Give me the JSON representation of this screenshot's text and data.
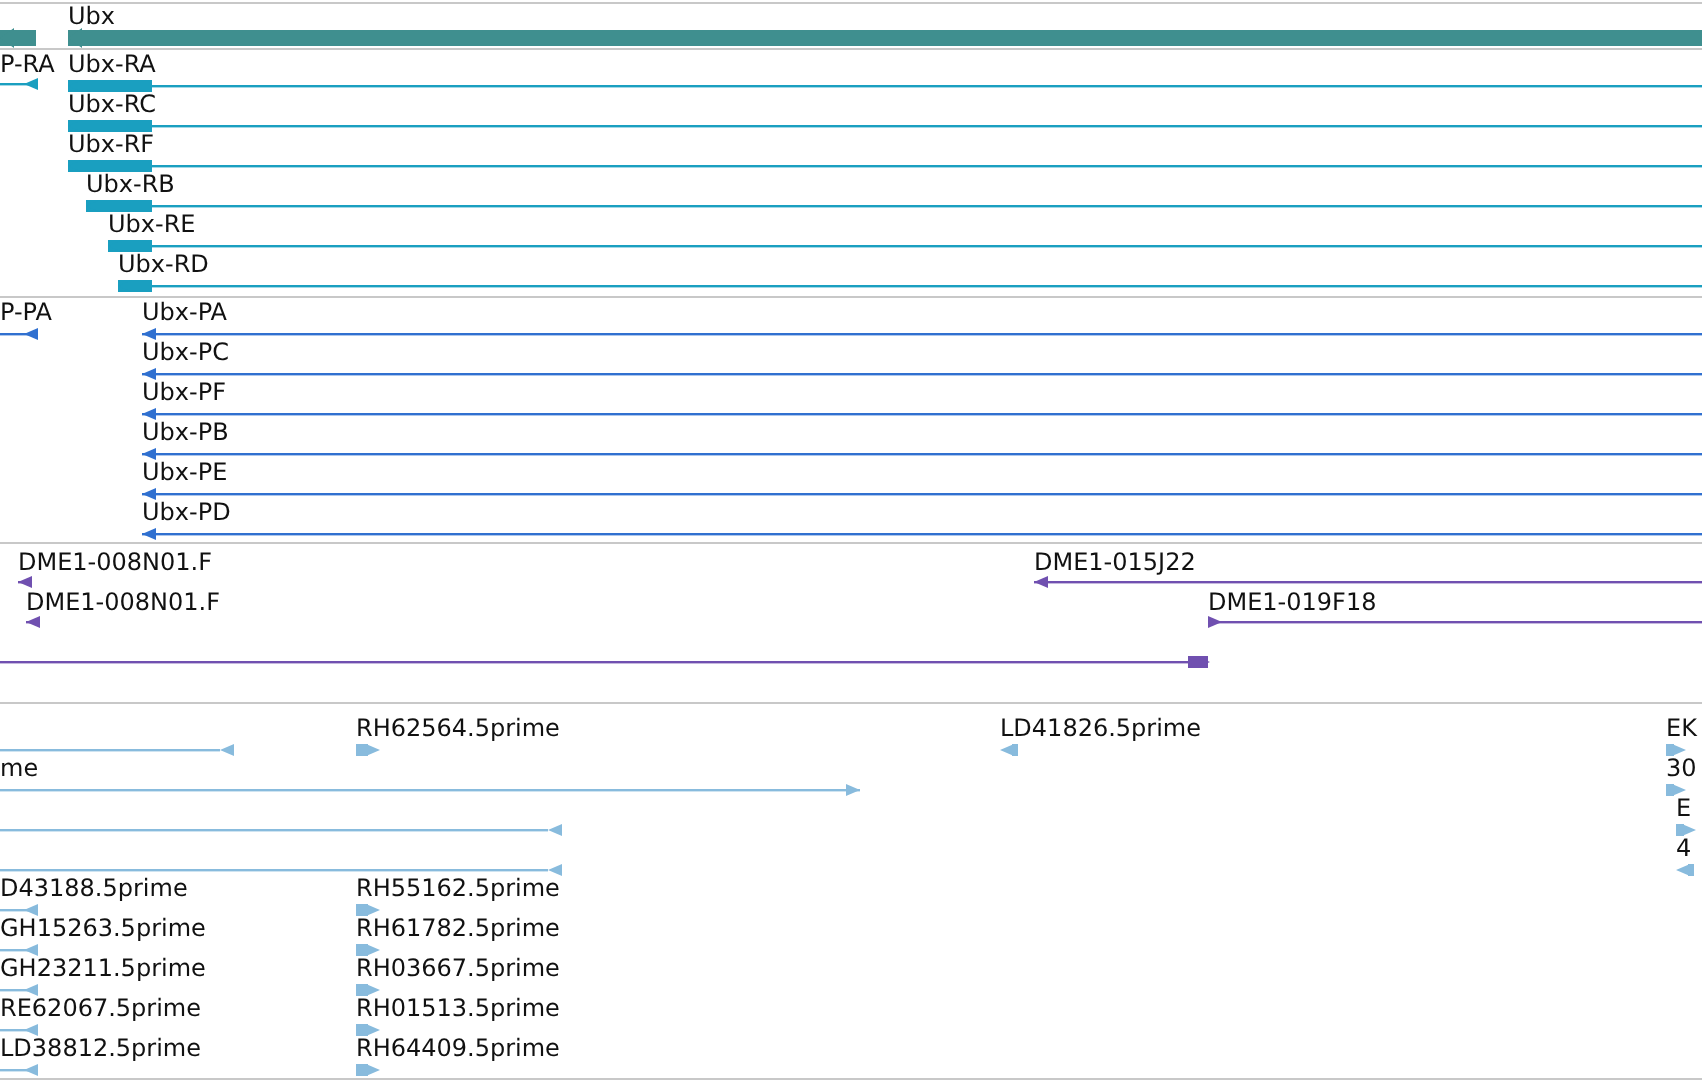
{
  "tracks": [
    {
      "kind": "gene",
      "features": [
        {
          "kind": "reverse"
        },
        {
          "label": "Ubx",
          "kind": "reverse"
        }
      ]
    },
    {
      "kind": "transcript",
      "features": [
        {
          "label": "P-RA",
          "kind": "reverse"
        },
        {
          "label": "Ubx-RA",
          "kind": "reverse"
        },
        {
          "label": "Ubx-RC",
          "kind": "reverse"
        },
        {
          "label": "Ubx-RF",
          "kind": "reverse"
        },
        {
          "label": "Ubx-RB",
          "kind": "reverse"
        },
        {
          "label": "Ubx-RE",
          "kind": "reverse"
        },
        {
          "label": "Ubx-RD",
          "kind": "reverse"
        }
      ]
    },
    {
      "kind": "protein",
      "features": [
        {
          "label": "P-PA",
          "kind": "reverse"
        },
        {
          "label": "Ubx-PA",
          "kind": "reverse"
        },
        {
          "label": "Ubx-PC",
          "kind": "reverse"
        },
        {
          "label": "Ubx-PF",
          "kind": "reverse"
        },
        {
          "label": "Ubx-PB",
          "kind": "reverse"
        },
        {
          "label": "Ubx-PE",
          "kind": "reverse"
        },
        {
          "label": "Ubx-PD",
          "kind": "reverse"
        }
      ]
    },
    {
      "kind": "clone",
      "features": [
        {
          "label": "DME1-008N01.F",
          "kind": "reverse"
        },
        {
          "label": "DME1-008N01.F",
          "kind": "reverse"
        },
        {
          "label": "DME1-015J22",
          "kind": "reverse"
        },
        {
          "label": "DME1-019F18",
          "kind": "forward"
        },
        {
          "kind": "forward"
        }
      ]
    },
    {
      "kind": "est",
      "features": [
        {
          "kind": "reverse"
        },
        {
          "label": "me",
          "kind": "forward"
        },
        {
          "kind": "reverse"
        },
        {
          "kind": "reverse"
        },
        {
          "label": "RH62564.5prime",
          "kind": "forward"
        },
        {
          "label": "LD41826.5prime",
          "kind": "reverse"
        },
        {
          "label": "EK",
          "kind": "forward"
        },
        {
          "label": "30",
          "kind": "forward"
        },
        {
          "label": "E",
          "kind": "forward"
        },
        {
          "label": "4",
          "kind": "reverse"
        },
        {
          "label": "D43188.5prime",
          "kind": "reverse"
        },
        {
          "label": "GH15263.5prime",
          "kind": "reverse"
        },
        {
          "label": "GH23211.5prime",
          "kind": "reverse"
        },
        {
          "label": "RE62067.5prime",
          "kind": "reverse"
        },
        {
          "label": "LD38812.5prime",
          "kind": "reverse"
        },
        {
          "label": "RH55162.5prime",
          "kind": "forward"
        },
        {
          "label": "RH61782.5prime",
          "kind": "forward"
        },
        {
          "label": "RH03667.5prime",
          "kind": "forward"
        },
        {
          "label": "RH01513.5prime",
          "kind": "forward"
        },
        {
          "label": "RH64409.5prime",
          "kind": "forward"
        }
      ]
    }
  ]
}
